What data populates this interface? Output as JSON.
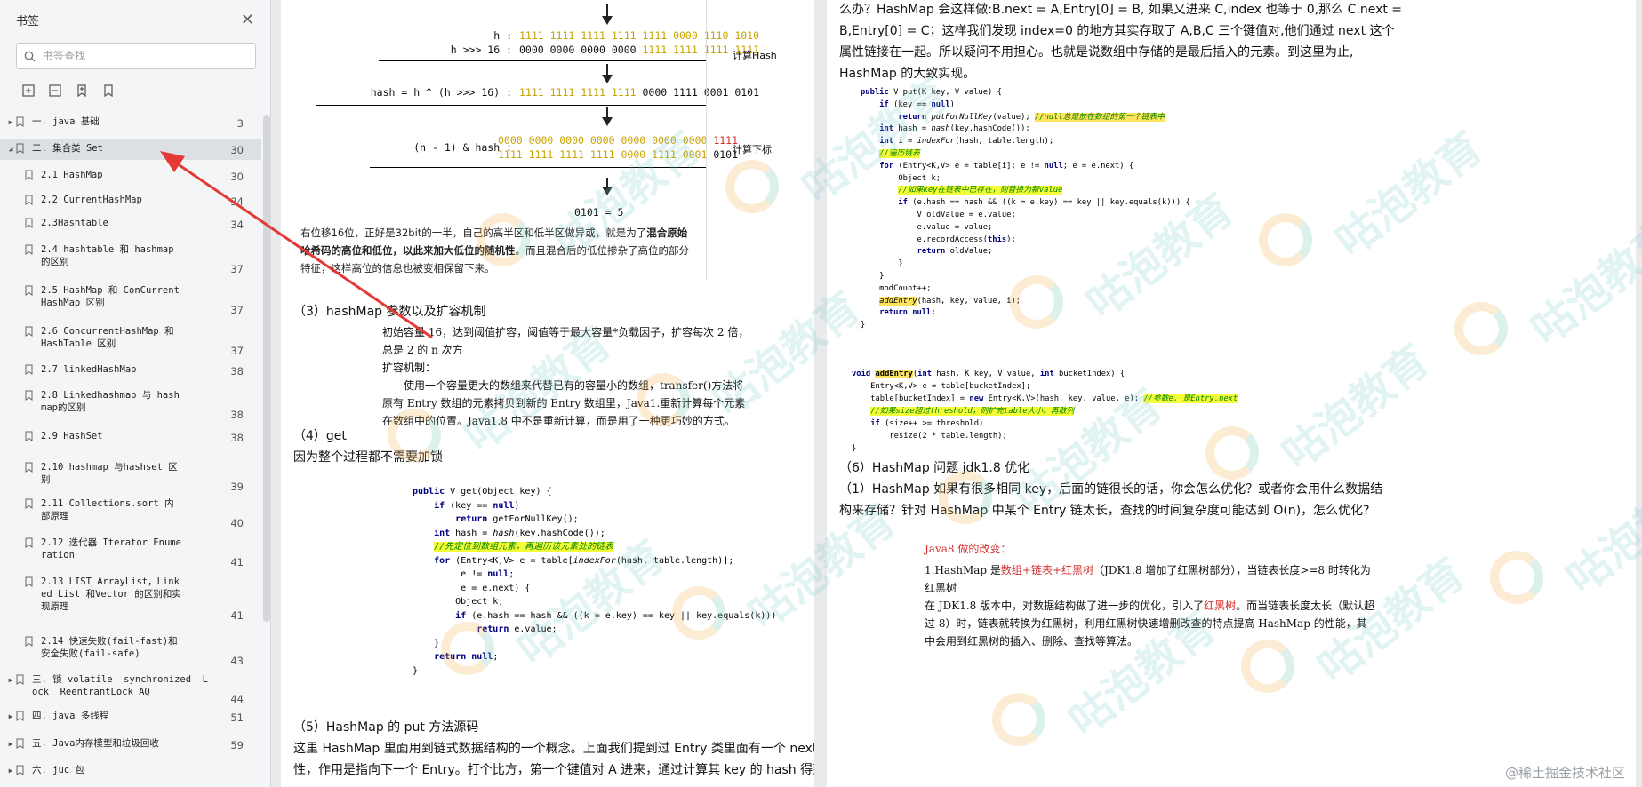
{
  "sidebar": {
    "title": "书签",
    "search_placeholder": "书签查找",
    "items": [
      {
        "label": "一. java 基础",
        "page": "3",
        "level": 0,
        "expandable": true,
        "expanded": false
      },
      {
        "label": "二. 集合类 Set",
        "page": "30",
        "level": 0,
        "expandable": true,
        "expanded": true,
        "selected": true
      },
      {
        "label": "2.1 HashMap",
        "page": "30",
        "level": 1
      },
      {
        "label": "2.2 CurrentHashMap",
        "page": "34",
        "level": 1
      },
      {
        "label": "2.3Hashtable",
        "page": "34",
        "level": 1
      },
      {
        "label": "2.4 hashtable 和 hashmap 的区别",
        "page": "37",
        "level": 1
      },
      {
        "label": "2.5 HashMap 和 ConCurrentHashMap 区别",
        "page": "37",
        "level": 1
      },
      {
        "label": "2.6 ConcurrentHashMap 和 HashTable 区别",
        "page": "37",
        "level": 1
      },
      {
        "label": "2.7 linkedHashMap",
        "page": "38",
        "level": 1
      },
      {
        "label": "2.8 Linkedhashmap 与 hashmap的区别",
        "page": "38",
        "level": 1
      },
      {
        "label": "2.9 HashSet",
        "page": "38",
        "level": 1
      },
      {
        "label": "2.10 hashmap 与hashset 区别",
        "page": "39",
        "level": 1
      },
      {
        "label": "2.11 Collections.sort 内部原理",
        "page": "40",
        "level": 1
      },
      {
        "label": "2.12 迭代器 Iterator Enumeration",
        "page": "41",
        "level": 1
      },
      {
        "label": "2.13 LIST ArrayList，Linked List 和Vector 的区别和实现原理",
        "page": "41",
        "level": 1
      },
      {
        "label": "2.14 快速失败(fail-fast)和安全失败(fail-safe)",
        "page": "43",
        "level": 1
      },
      {
        "label": "三. 锁 volatile  synchronized  Lock  ReentrantLock AQ",
        "page": "44",
        "level": 0,
        "expandable": true
      },
      {
        "label": "四. java 多线程",
        "page": "51",
        "level": 0,
        "expandable": true
      },
      {
        "label": "五. Java内存模型和垃圾回收",
        "page": "59",
        "level": 0,
        "expandable": true
      },
      {
        "label": "六. juc 包",
        "page": "",
        "level": 0,
        "expandable": true
      }
    ]
  },
  "page1": {
    "diagram": {
      "h_label": "h :",
      "h_bits": "1111 1111 1111 1111 1111 0000 1110 1010",
      "shift_label": "h >>> 16 :",
      "shift_bits_a": "0000 0000 0000 0000 ",
      "shift_bits_b": "1111 1111 1111 1111",
      "calc_hash": "计算Hash",
      "hash_label": "hash = h ^ (h >>> 16) :",
      "hash_bits_a": "1111 1111 1111 1111 ",
      "hash_bits_b": "0000 1111 0001 0101",
      "n_label": "(n  -  1) & hash :",
      "n_bits1_a": "0000 0000 0000 0000 0000 0000 0000 ",
      "n_bits1_b": "1111",
      "n_bits2_a": "1111 1111 1111 1111 0000 1111 0001 ",
      "n_bits2_b": "0101",
      "calc_index": "计算下标",
      "result": "0101 = 5"
    },
    "para1_a": "右位移16位，正好是32bit的一半，自己的高半区和低半区做异或，就是为了",
    "para1_b": "混合原始哈希码的高位和低位，以此来加大低位的随机性",
    "para1_c": "。而且混合后的低位掺杂了高位的部分特征，这样高位的信息也被变相保留下来。",
    "h3": "（3）hashMap 参数以及扩容机制",
    "p3_1": "初始容量 16，达到阈值扩容，阈值等于最大容量*负载因子，扩容每次 2 倍，总是 2 的 n 次方",
    "p3_2": "扩容机制：",
    "p3_3": "使用一个容量更大的数组来代替已有的容量小的数组，transfer()方法将原有 Entry 数组的元素拷贝到新的 Entry 数组里，Java1.重新计算每个元素在数组中的位置。Java1.8 中不是重新计算，而是用了一种更巧妙的方式。",
    "h4": "（4）get",
    "p4": "因为整个过程都不需要加锁",
    "code_get": [
      "public V get(Object key) {",
      "    if (key == null)",
      "        return getForNullKey();",
      "    int hash = hash(key.hashCode());",
      "    //先定位到数组元素，再遍历该元素处的链表",
      "    for (Entry<K,V> e = table[indexFor(hash, table.length)];",
      "         e != null;",
      "         e = e.next) {",
      "        Object k;",
      "        if (e.hash == hash && ((k = e.key) == key || key.equals(k)))",
      "            return e.value;",
      "    }",
      "    return null;",
      "}"
    ],
    "h5": "（5）HashMap 的 put 方法源码",
    "p5_1": "这里 HashMap 里面用到链式数据结构的一个概念。上面我们提到过 Entry 类里面有一个 next 属",
    "p5_2": "性，作用是指向下一个 Entry。打个比方，第一个键值对 A 进来，通过计算其 key 的 hash 得到的"
  },
  "page2": {
    "top_1": "么办？HashMap 会这样做:B.next = A,Entry[0] = B, 如果又进来 C,index 也等于 0,那么 C.next =",
    "top_2": "B,Entry[0] = C；这样我们发现 index=0 的地方其实存取了 A,B,C 三个键值对,他们通过 next 这个",
    "top_3": "属性链接在一起。所以疑问不用担心。也就是说数组中存储的是最后插入的元素。到这里为止,",
    "top_4": "HashMap 的大致实现。",
    "code_put": [
      "public V put(K key, V value) {",
      "    if (key == null)",
      "        return putForNullKey(value); //null总是放在数组的第一个链表中",
      "    int hash = hash(key.hashCode());",
      "    int i = indexFor(hash, table.length);",
      "    //遍历链表",
      "    for (Entry<K,V> e = table[i]; e != null; e = e.next) {",
      "        Object k;",
      "        //如果key在链表中已存在，则替换为新value",
      "        if (e.hash == hash && ((k = e.key) == key || key.equals(k))) {",
      "            V oldValue = e.value;",
      "            e.value = value;",
      "            e.recordAccess(this);",
      "            return oldValue;",
      "        }",
      "    }",
      "    modCount++;",
      "    addEntry(hash, key, value, i);",
      "    return null;",
      "}"
    ],
    "code_add": [
      "void addEntry(int hash, K key, V value, int bucketIndex) {",
      "    Entry<K,V> e = table[bucketIndex];",
      "    table[bucketIndex] = new Entry<K,V>(hash, key, value, e); //参数e, 是Entry.next",
      "    //如果size超过threshold，则扩充table大小。再散列",
      "    if (size++ >= threshold)",
      "        resize(2 * table.length);",
      "}"
    ],
    "h6": "（6）HashMap 问题 jdk1.8 优化",
    "q1_1": "（1）HashMap 如果有很多相同 key，后面的链很长的话，你会怎么优化？或者你会用什么数据结",
    "q1_2": "构来存储？针对 HashMap 中某个 Entry 链太长，查找的时间复杂度可能达到 O(n)，怎么优化?",
    "j8_title": "Java8 做的改变：",
    "j8_1a": "1.HashMap 是",
    "j8_1b": "数组+链表+红黑树",
    "j8_1c": "（JDK1.8 增加了红黑树部分），当链表长度>=8 时转化为红黑树",
    "j8_2a": "在 JDK1.8 版本中，对数据结构做了进一步的优化，引入了",
    "j8_2b": "红黑树",
    "j8_2c": "。而当链表长度太长（默认超过 8）时，链表就转换为红黑树，利用红黑树快速增删改查的特点提高 HashMap 的性能，其中会用到红黑树的插入、删除、查找等算法。"
  },
  "watermark": {
    "text": "咕泡教育",
    "corner": "@稀土掘金技术社区"
  },
  "colors": {
    "accent_red": "#e53935",
    "bits_highlight": "#c8a400",
    "red_text": "#d32f2f",
    "code_highlight": "#f5ff38"
  }
}
